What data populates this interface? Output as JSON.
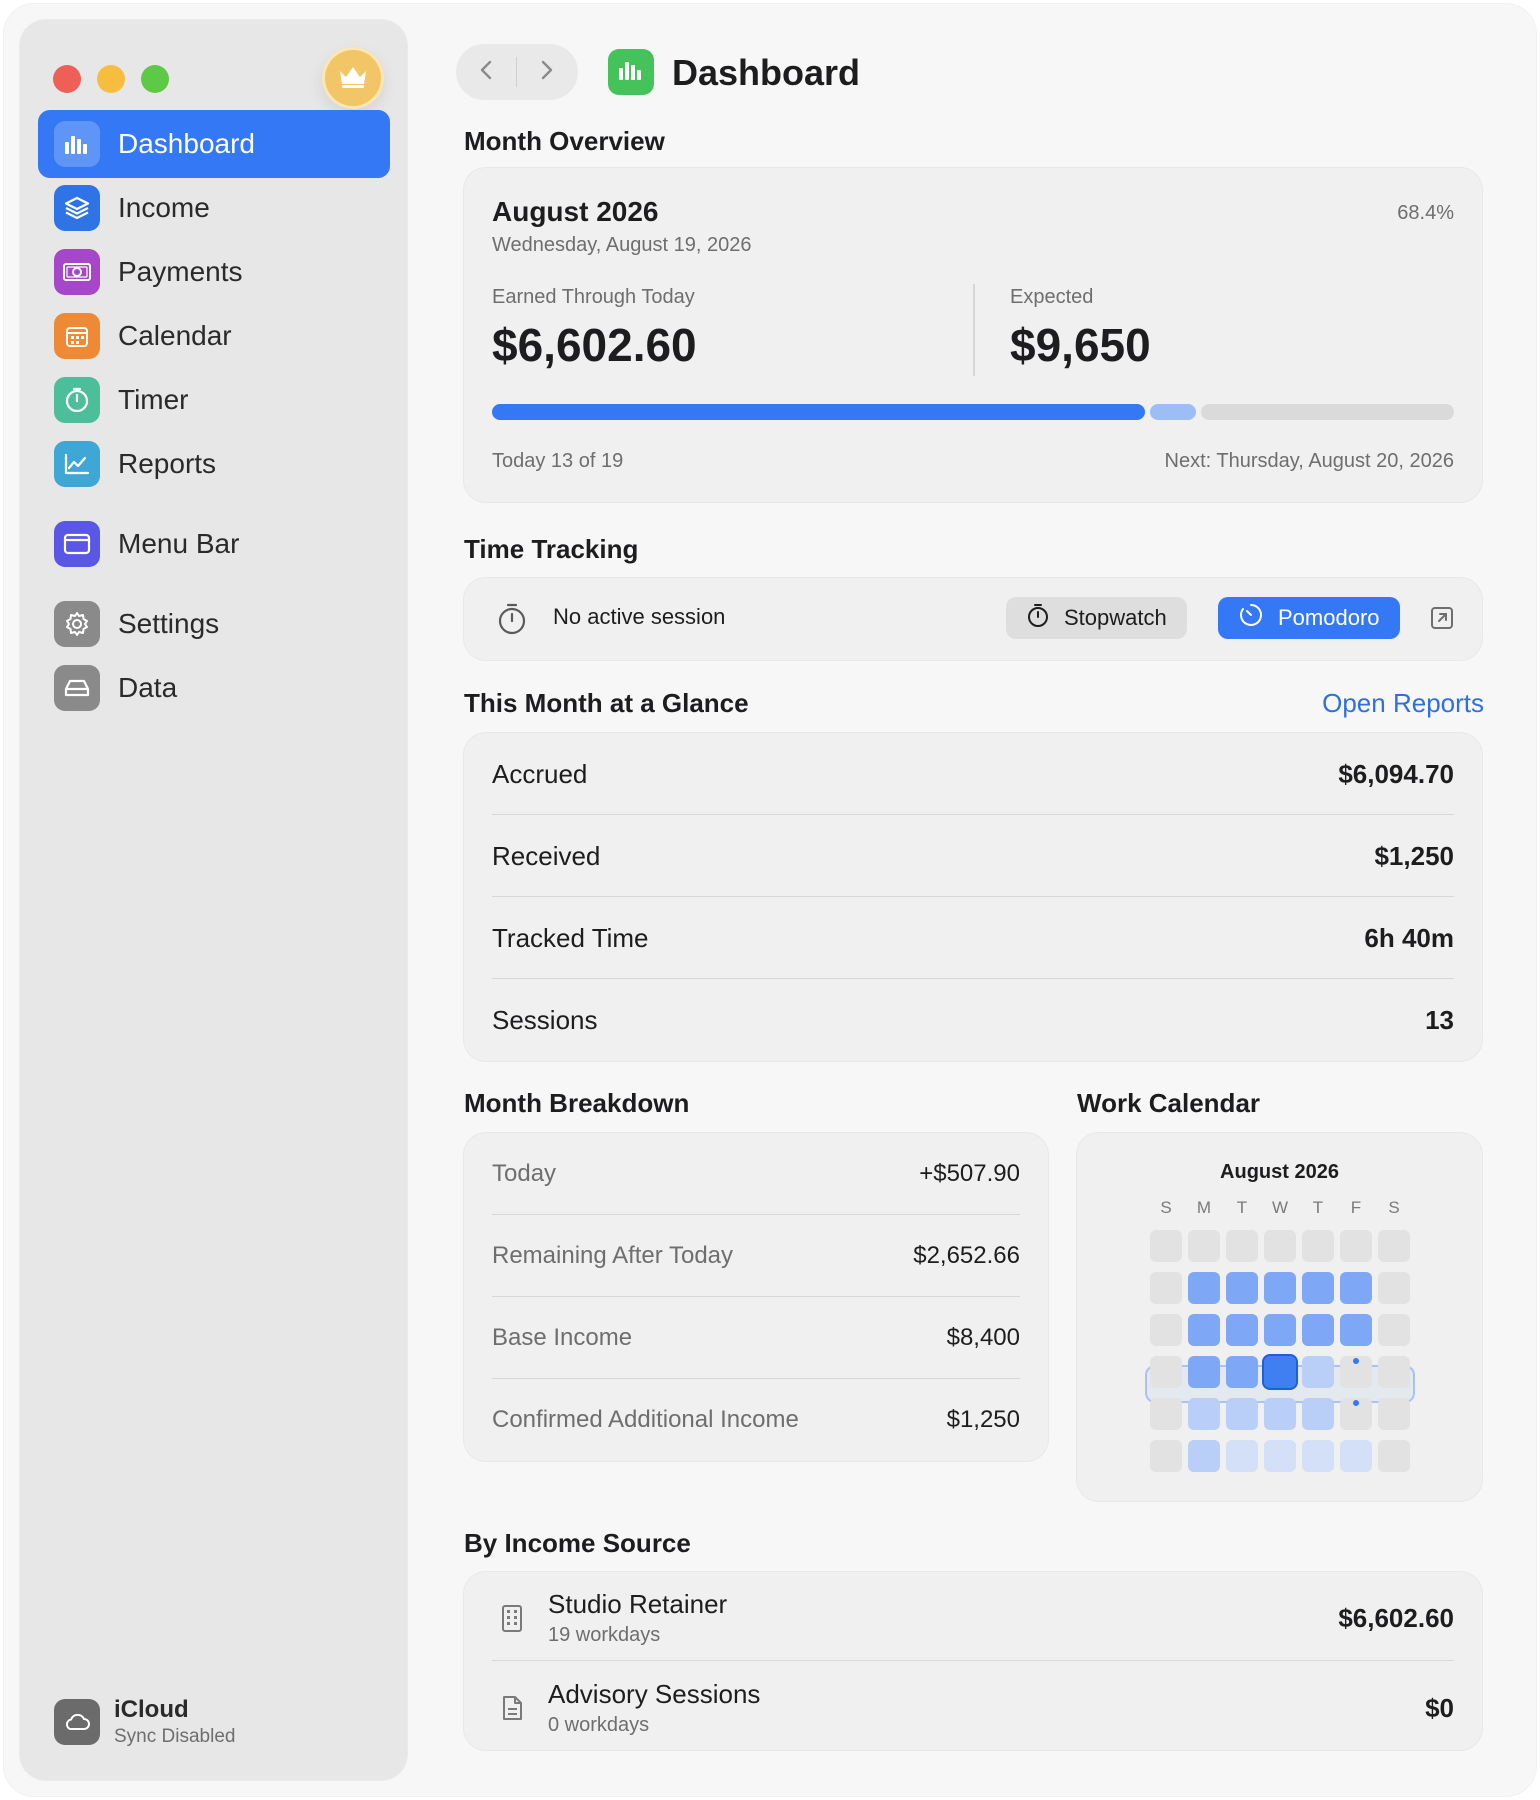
{
  "sidebar": {
    "items": [
      {
        "label": "Dashboard",
        "icon": "chart-bars-icon",
        "color": "#3478f6",
        "active": true
      },
      {
        "label": "Income",
        "icon": "stack-layers-icon",
        "color": "#2f74e6"
      },
      {
        "label": "Payments",
        "icon": "banknote-icon",
        "color": "#a646c9"
      },
      {
        "label": "Calendar",
        "icon": "calendar-icon",
        "color": "#ee8a35"
      },
      {
        "label": "Timer",
        "icon": "timer-icon",
        "color": "#4cbf9a"
      },
      {
        "label": "Reports",
        "icon": "line-chart-icon",
        "color": "#3ea7d6"
      },
      {
        "label": "Menu Bar",
        "icon": "menubar-window-icon",
        "color": "#5b57e6"
      },
      {
        "label": "Settings",
        "icon": "gear-icon",
        "color": "#8a8a8a"
      },
      {
        "label": "Data",
        "icon": "drive-icon",
        "color": "#8a8a8a"
      }
    ],
    "icloud": {
      "title": "iCloud",
      "status": "Sync Disabled"
    }
  },
  "header": {
    "title": "Dashboard"
  },
  "month_overview": {
    "section_title": "Month Overview",
    "month": "August 2026",
    "date": "Wednesday, August 19, 2026",
    "percent": "68.4%",
    "earned_label": "Earned Through Today",
    "earned_value": "$6,602.60",
    "expected_label": "Expected",
    "expected_value": "$9,650",
    "progress_earned_fraction": 0.684,
    "progress_today_fraction": 0.053,
    "today_text": "Today 13 of 19",
    "next_text": "Next: Thursday, August 20, 2026"
  },
  "time_tracking": {
    "section_title": "Time Tracking",
    "status": "No active session",
    "stopwatch_label": "Stopwatch",
    "pomodoro_label": "Pomodoro"
  },
  "glance": {
    "section_title": "This Month at a Glance",
    "link_label": "Open Reports",
    "rows": [
      {
        "label": "Accrued",
        "value": "$6,094.70"
      },
      {
        "label": "Received",
        "value": "$1,250"
      },
      {
        "label": "Tracked Time",
        "value": "6h 40m"
      },
      {
        "label": "Sessions",
        "value": "13"
      }
    ]
  },
  "breakdown": {
    "section_title": "Month Breakdown",
    "rows": [
      {
        "label": "Today",
        "value": "+$507.90"
      },
      {
        "label": "Remaining After Today",
        "value": "$2,652.66"
      },
      {
        "label": "Base Income",
        "value": "$8,400"
      },
      {
        "label": "Confirmed Additional Income",
        "value": "$1,250"
      }
    ]
  },
  "work_calendar": {
    "section_title": "Work Calendar",
    "month": "August 2026",
    "weekdays": [
      "S",
      "M",
      "T",
      "W",
      "T",
      "F",
      "S"
    ]
  },
  "income_sources": {
    "section_title": "By Income Source",
    "items": [
      {
        "name": "Studio Retainer",
        "sub": "19 workdays",
        "value": "$6,602.60",
        "icon": "building-icon"
      },
      {
        "name": "Advisory Sessions",
        "sub": "0 workdays",
        "value": "$0",
        "icon": "document-icon"
      }
    ]
  }
}
